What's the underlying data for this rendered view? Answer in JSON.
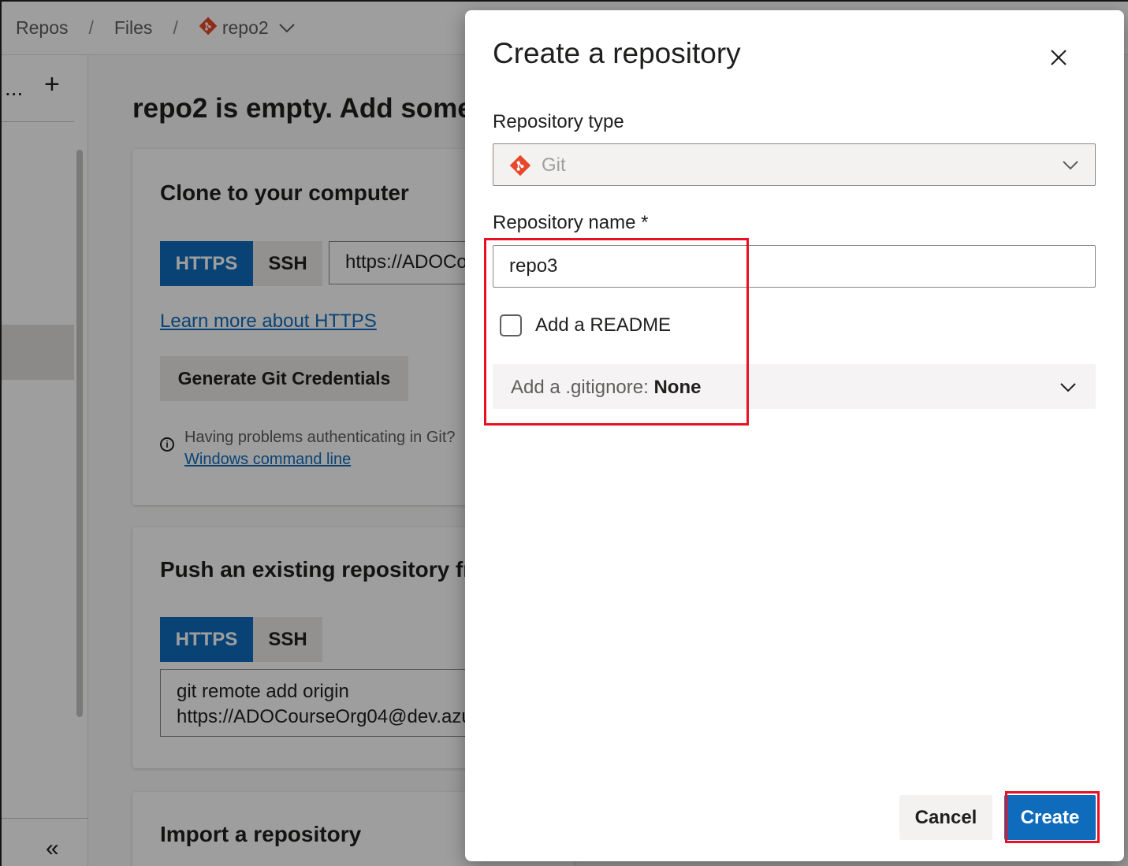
{
  "breadcrumb": {
    "items": [
      "Repos",
      "Files",
      "repo2"
    ],
    "separator": "/"
  },
  "sidebar": {
    "more_label": "...",
    "add_label": "+",
    "collapse_label": "«"
  },
  "main": {
    "heading": "repo2 is empty. Add some",
    "clone_card": {
      "title": "Clone to your computer",
      "tab_https": "HTTPS",
      "tab_ssh": "SSH",
      "clone_url": "https://ADOCo",
      "learn_more_link": "Learn more about HTTPS",
      "generate_button": "Generate Git Credentials",
      "help_text": "Having problems authenticating in Git?",
      "help_link": "Windows command line",
      "help_link_suffix": "."
    },
    "push_card": {
      "title": "Push an existing repository fr",
      "tab_https": "HTTPS",
      "tab_ssh": "SSH",
      "command_line1": "git remote add origin",
      "command_line2": "https://ADOCourseOrg04@dev.azu"
    },
    "import_card": {
      "title": "Import a repository"
    }
  },
  "dialog": {
    "title": "Create a repository",
    "repo_type_label": "Repository type",
    "repo_type_value": "Git",
    "repo_name_label": "Repository name *",
    "repo_name_value": "repo3",
    "readme_label": "Add a README",
    "readme_checked": false,
    "gitignore_label": "Add a .gitignore:",
    "gitignore_value": "None",
    "cancel_label": "Cancel",
    "create_label": "Create"
  },
  "colors": {
    "accent": "#0f6cbd",
    "git_brand": "#e8472b",
    "highlight": "#e81123"
  },
  "icons": [
    "git-icon",
    "chevron-down-icon",
    "close-icon",
    "plus-icon",
    "more-icon",
    "info-icon",
    "collapse-icon"
  ]
}
